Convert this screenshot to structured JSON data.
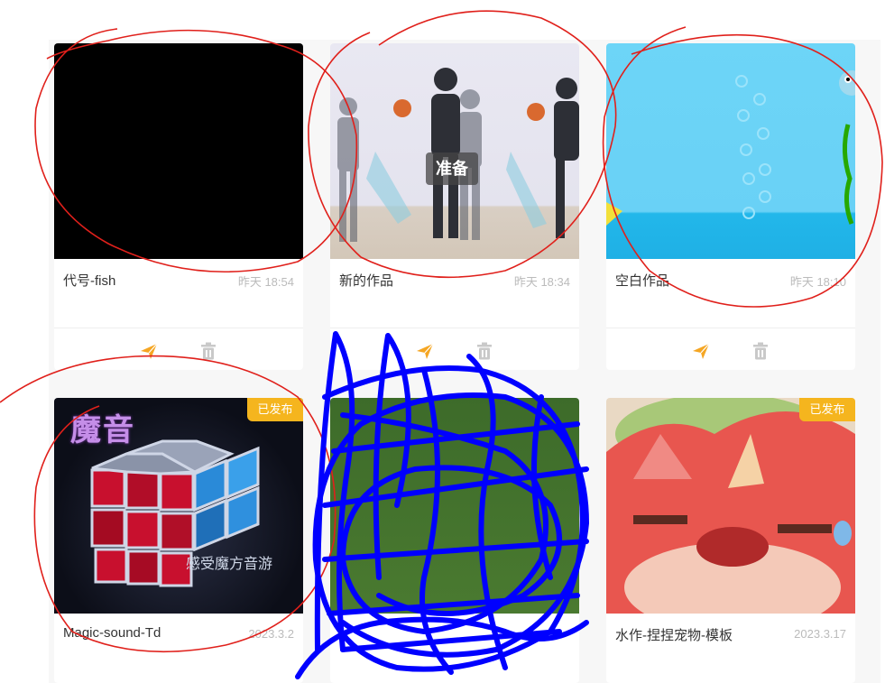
{
  "cards": [
    {
      "title": "代号-fish",
      "date": "昨天 18:54"
    },
    {
      "title": "新的作品",
      "date": "昨天 18:34",
      "overlay_label": "准备"
    },
    {
      "title": "空白作品",
      "date": "昨天 18:10"
    },
    {
      "title": "Magic-sound-Td",
      "date": "2023.3.2",
      "badge": "已发布",
      "thumb_heading": "魔音",
      "thumb_caption": "感受魔方音游"
    },
    {
      "title": "",
      "date": "",
      "badge": ""
    },
    {
      "title": "水作-捏捏宠物-模板",
      "date": "2023.3.17",
      "badge": "已发布"
    }
  ],
  "actions": {
    "publish_icon": "paper-plane-icon",
    "delete_icon": "trash-icon"
  },
  "colors": {
    "accent": "#f5a623",
    "badge": "#f5b51e",
    "annotation_red": "#e0201b",
    "annotation_blue": "#0000ff"
  }
}
